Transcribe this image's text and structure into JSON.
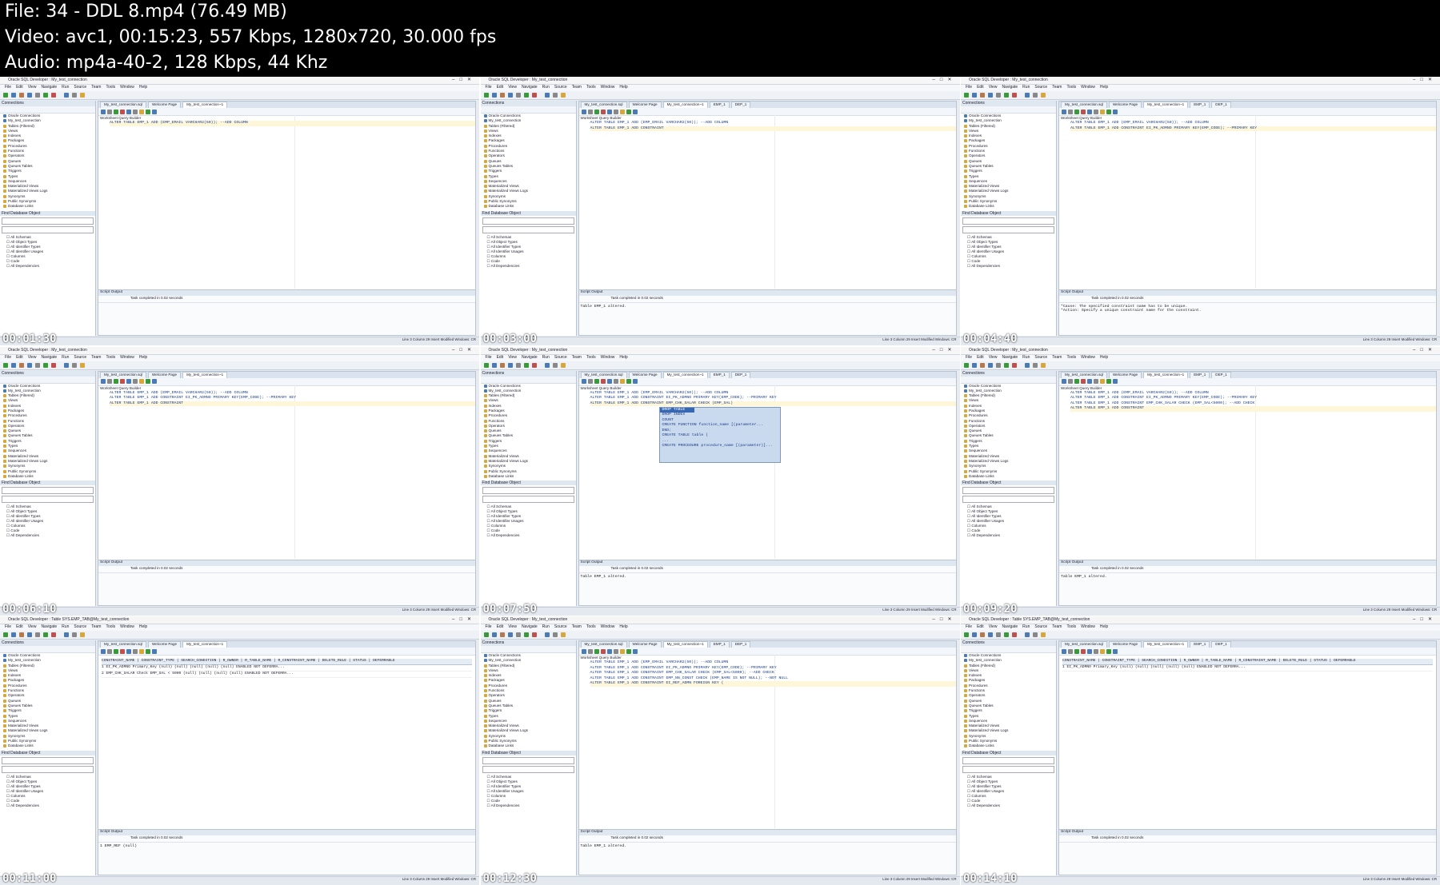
{
  "header": {
    "line1": "File: 34 - DDL 8.mp4 (76.49 MB)",
    "line2": "Video: avc1, 00:15:23, 557 Kbps, 1280x720, 30.000 fps",
    "line3": "Audio: mp4a-40-2, 128 Kbps, 44 Khz"
  },
  "app": {
    "title": "Oracle SQL Developer : My_test_connection",
    "title_table": "Oracle SQL Developer : Table SYS.EMP_TAB@My_test_connection",
    "menu": [
      "File",
      "Edit",
      "View",
      "Navigate",
      "Run",
      "Source",
      "Team",
      "Tools",
      "Window",
      "Help"
    ],
    "connections_header": "Connections",
    "connection_root": "Oracle Connections",
    "connection_name": "My_test_connection",
    "tree_items": [
      "Tables (Filtered)",
      "Views",
      "Indexes",
      "Packages",
      "Procedures",
      "Functions",
      "Operators",
      "Queues",
      "Queues Tables",
      "Triggers",
      "Types",
      "Sequences",
      "Materialized Views",
      "Materialized Views Logs",
      "Synonyms",
      "Public Synonyms",
      "Database Links"
    ],
    "find_header": "Find Database Object",
    "find_items": [
      "All Schemas",
      "All Object Types",
      "All Identifier Types",
      "All Identifier Usages",
      "Columns",
      "Code",
      "All Dependencies"
    ],
    "editor_tabs": [
      "My_test_connection.sql",
      "Welcome Page",
      "My_test_connection~1",
      "EMP_1",
      "DEP_1"
    ],
    "worksheet_tab": "Worksheet",
    "query_builder_tab": "Query Builder",
    "script_output": "Script Output",
    "task_done": "Task completed in 0.02 seconds",
    "status_right": "Line 3 Column 29   Insert   Modified   Windows: CR"
  },
  "tiles": [
    {
      "ts": "00:01:30",
      "code": [
        "ALTER TABLE EMP_1 ADD (EMP_EMAIL VARCHAR2(50)); --ADD COLUMN"
      ],
      "output": ""
    },
    {
      "ts": "00:03:00",
      "code": [
        "ALTER TABLE EMP_1 ADD (EMP_EMAIL VARCHAR2(50)); --ADD COLUMN",
        "ALTER TABLE EMP_1 ADD CONSTRAINT"
      ],
      "output": "Table EMP_1 altered."
    },
    {
      "ts": "00:04:40",
      "code": [
        "ALTER TABLE EMP_1 ADD (EMP_EMAIL VARCHAR2(50)); --ADD COLUMN",
        "ALTER TABLE EMP_1 ADD CONSTRAINT EI_PK_ADMNO PRIMARY KEY(EMP_CODE); --PRIMARY KEY"
      ],
      "output": "*Cause:    The specified constraint name has to be unique.\n*Action:   Specify a unique constraint name for the constraint."
    },
    {
      "ts": "00:06:10",
      "code": [
        "ALTER TABLE EMP_1 ADD (EMP_EMAIL VARCHAR2(50)); --ADD COLUMN",
        "ALTER TABLE EMP_1 ADD CONSTRAINT EI_PK_ADMNO PRIMARY KEY(EMP_CODE); --PRIMARY KEY",
        "ALTER TABLE EMP_1 ADD CONSTRAINT"
      ],
      "output": ""
    },
    {
      "ts": "00:07:50",
      "code": [
        "ALTER TABLE EMP_1 ADD (EMP_EMAIL VARCHAR2(50)); --ADD COLUMN",
        "ALTER TABLE EMP_1 ADD CONSTRAINT EI_PK_ADMNO PRIMARY KEY(EMP_CODE); --PRIMARY KEY",
        "ALTER TABLE EMP_1 ADD CONSTRAINT EMP_CHK_SALAR CHECK (EMP_SAL)"
      ],
      "output": "Table EMP_1 altered.",
      "popup": [
        "DROP TABLE",
        "DROP INDEX",
        "COUNT",
        "CREATE FUNCTION function_name    [(parameter...",
        "END;",
        "CREATE TABLE table (",
        "...",
        "CREATE PROCEDURE procedure_name    [(parameter)]..."
      ]
    },
    {
      "ts": "00:09:20",
      "code": [
        "ALTER TABLE EMP_1 ADD (EMP_EMAIL VARCHAR2(50)); --ADD COLUMN",
        "ALTER TABLE EMP_1 ADD CONSTRAINT EI_PK_ADMNO PRIMARY KEY(EMP_CODE); --PRIMARY KEY",
        "ALTER TABLE EMP_1 ADD CONSTRAINT EMP_CHK_SALAR CHECK (EMP_SAL<5000); --ADD CHECK",
        "ALTER TABLE EMP_1 ADD CONSTRAINT"
      ],
      "output": "Table EMP_1 altered."
    },
    {
      "ts": "00:11:00",
      "table": true,
      "columns": [
        "CONSTRAINT_NAME",
        "CONSTRAINT_TYPE",
        "SEARCH_CONDITION",
        "R_OWNER",
        "R_TABLE_NAME",
        "R_CONSTRAINT_NAME",
        "DELETE_RULE",
        "STATUS",
        "DEFERRABLE"
      ],
      "rows": [
        [
          "1 EI_PK_ADMNO",
          "Primary_Key",
          "(null)",
          "(null)",
          "(null)",
          "(null)",
          "(null)",
          "ENABLED",
          "NOT DEFERRA..."
        ],
        [
          "2 EMP_CHK_SALAR",
          "Check",
          "EMP_SAL < 5000",
          "(null)",
          "(null)",
          "(null)",
          "(null)",
          "ENABLED",
          "NOT DEFERRA..."
        ]
      ],
      "output": "1 EMP_REF        (null)"
    },
    {
      "ts": "00:12:30",
      "code": [
        "ALTER TABLE EMP_1 ADD (EMP_EMAIL VARCHAR2(50)); --ADD COLUMN",
        "ALTER TABLE EMP_1 ADD CONSTRAINT EI_PK_ADMNO PRIMARY KEY(EMP_CODE); --PRIMARY KEY",
        "ALTER TABLE EMP_1 ADD CONSTRAINT EMP_CHK_SALAR CHECK (EMP_SAL<5000); --ADD CHECK",
        "ALTER TABLE EMP_1 ADD CONSTRAINT EMP_NN_CONST CHECK (EMP_NAME IS NOT NULL); --NOT NULL",
        "ALTER TABLE EMP_1 ADD CONSTRAINT EI_REF_ADMN FOREIGN KEY ("
      ],
      "output": "Table EMP_1 altered."
    },
    {
      "ts": "00:14:10",
      "table": true,
      "columns": [
        "CONSTRAINT_NAME",
        "CONSTRAINT_TYPE",
        "SEARCH_CONDITION",
        "R_OWNER",
        "R_TABLE_NAME",
        "R_CONSTRAINT_NAME",
        "DELETE_RULE",
        "STATUS",
        "DEFERRABLE"
      ],
      "rows": [
        [
          "1 EI_PK_ADMNO",
          "Primary_Key",
          "(null)",
          "(null)",
          "(null)",
          "(null)",
          "(null)",
          "ENABLED",
          "NOT DEFERRA..."
        ]
      ],
      "output": ""
    }
  ]
}
